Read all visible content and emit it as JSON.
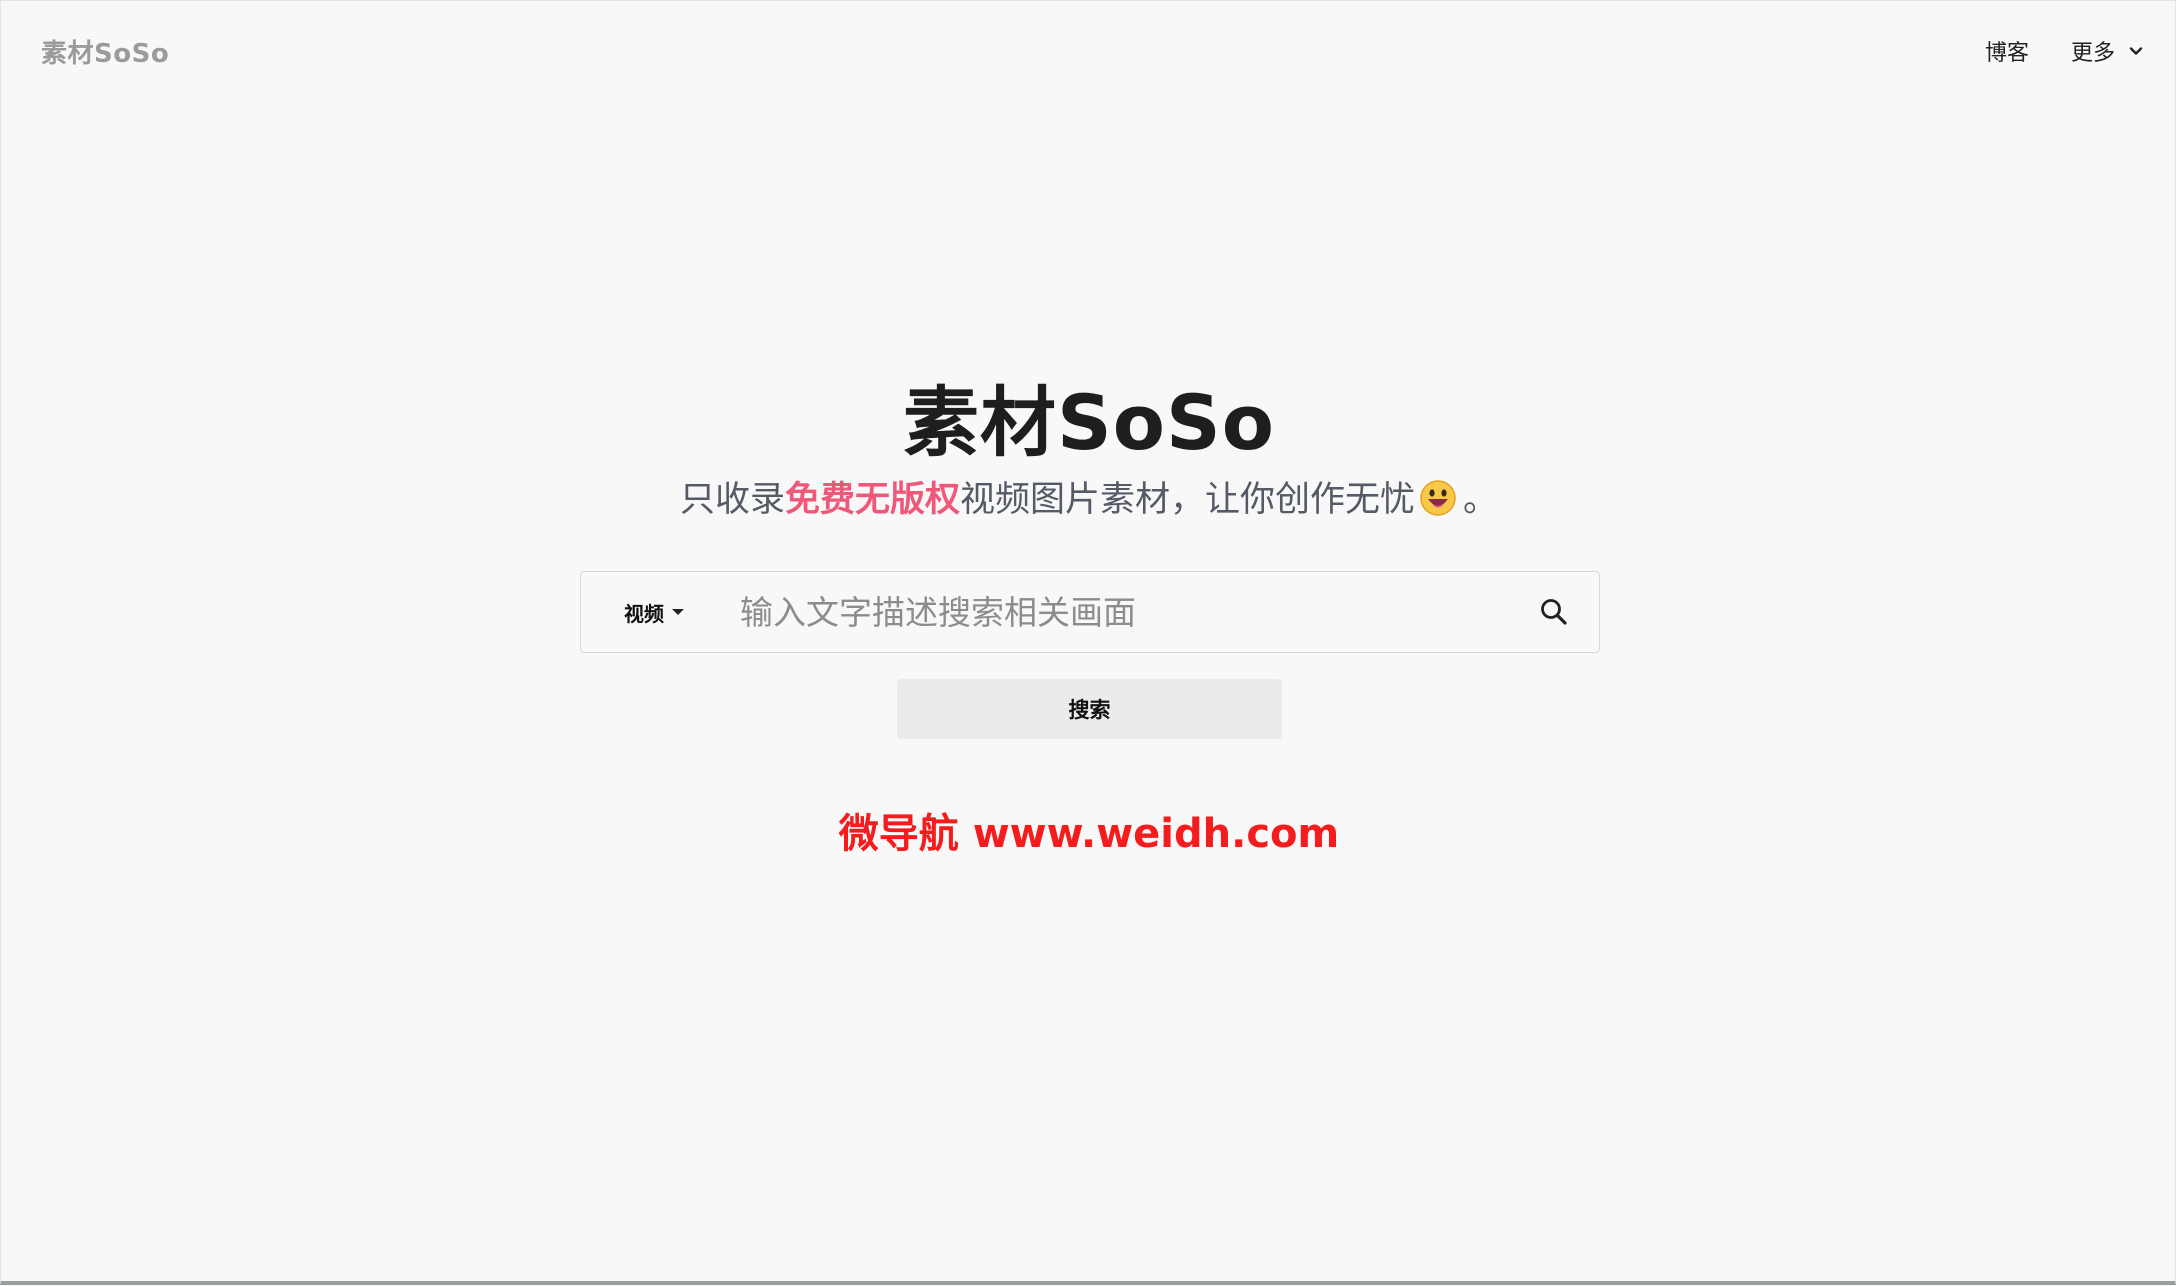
{
  "nav": {
    "logo": "素材SoSo",
    "blog_label": "博客",
    "more_label": "更多"
  },
  "hero": {
    "title": "素材SoSo",
    "subtitle_before": "只收录",
    "subtitle_highlight": "免费无版权",
    "subtitle_after": "视频图片素材，让你创作无忧",
    "subtitle_end": "。",
    "highlight_color": "#f0587a"
  },
  "search": {
    "type_selected": "视频",
    "placeholder": "输入文字描述搜索相关画面",
    "value": "",
    "button_label": "搜索"
  },
  "watermark": {
    "text": "微导航 www.weidh.com",
    "color": "#f41c1c"
  }
}
